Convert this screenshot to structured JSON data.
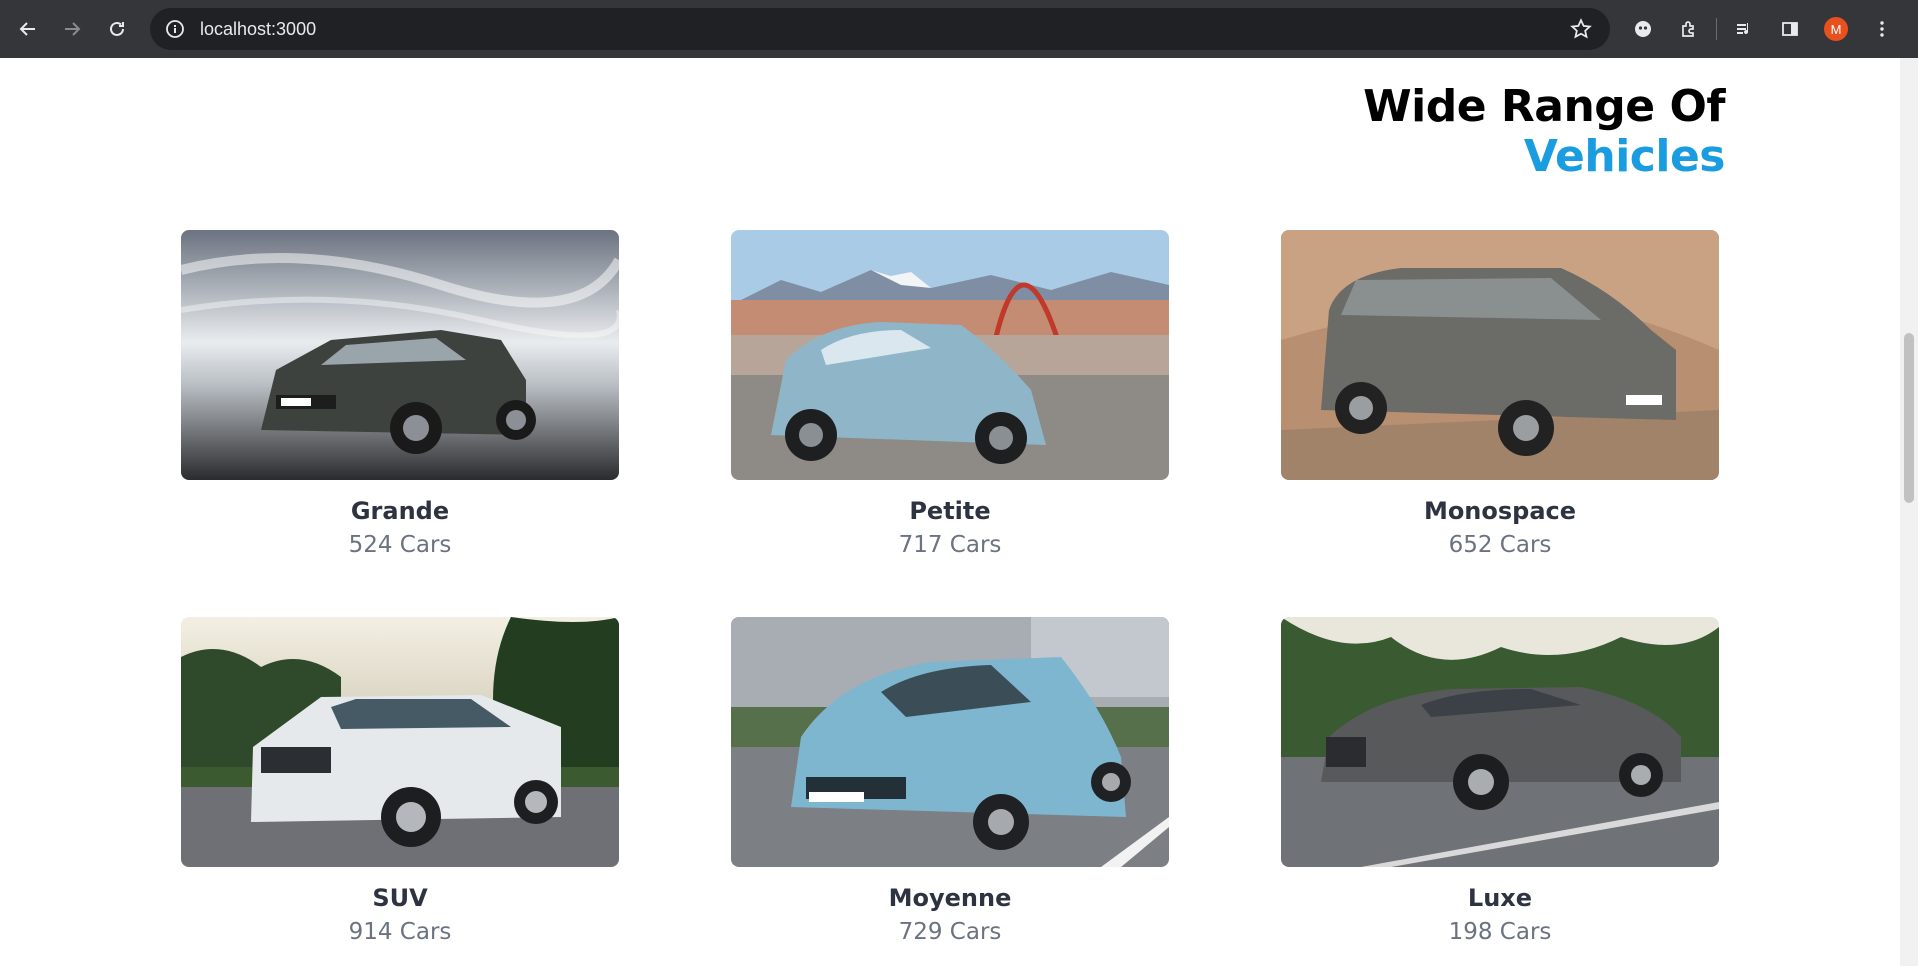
{
  "browser": {
    "url": "localhost:3000",
    "profile_initial": "M"
  },
  "heading": {
    "line1": "Wide Range Of",
    "line2": "Vehicles",
    "accent_color": "#1a9de0"
  },
  "categories": [
    {
      "name": "Grande",
      "count": "524 Cars"
    },
    {
      "name": "Petite",
      "count": "717 Cars"
    },
    {
      "name": "Monospace",
      "count": "652 Cars"
    },
    {
      "name": "SUV",
      "count": "914 Cars"
    },
    {
      "name": "Moyenne",
      "count": "729 Cars"
    },
    {
      "name": "Luxe",
      "count": "198 Cars"
    }
  ]
}
